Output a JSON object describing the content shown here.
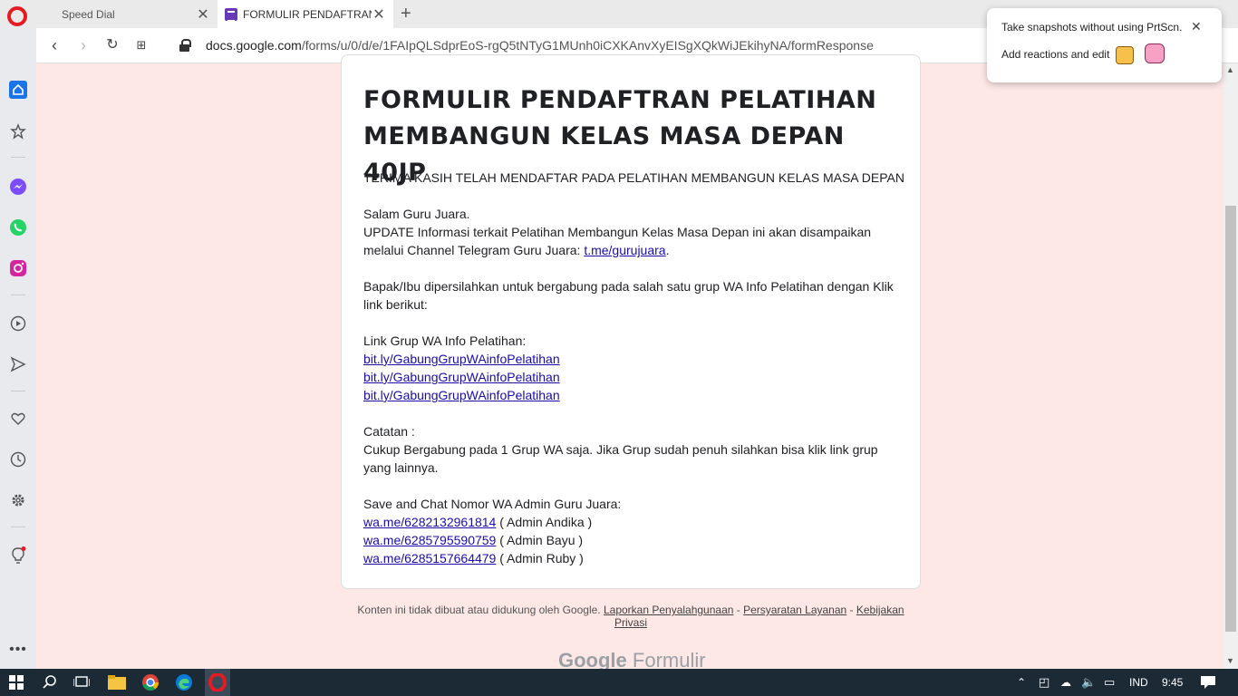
{
  "tabs": [
    {
      "label": "Speed Dial",
      "icon": "speed-dial-icon"
    },
    {
      "label": "FORMULIR PENDAFTRAN P",
      "icon": "google-forms-icon"
    }
  ],
  "address": {
    "domain": "docs.google.com",
    "path": "/forms/u/0/d/e/1FAIpQLSdprEoS-rgQ5tNTyG1MUnh0iCXKAnvXyEISgXQkWiJEkihyNA/formResponse"
  },
  "popup": {
    "line1": "Take snapshots without using PrtScn.",
    "line2": "Add reactions and edit"
  },
  "form": {
    "title": "FORMULIR PENDAFTRAN PELATIHAN MEMBANGUN KELAS MASA DEPAN 40JP",
    "thanks": "TERIMA KASIH TELAH MENDAFTAR PADA PELATIHAN MEMBANGUN KELAS MASA DEPAN",
    "greeting": "Salam Guru Juara.",
    "update_text": "UPDATE Informasi terkait Pelatihan Membangun Kelas Masa Depan ini akan disampaikan melalui Channel Telegram Guru Juara: ",
    "telegram_link": "t.me/gurujuara",
    "invite_text": "Bapak/Ibu dipersilahkan untuk bergabung pada salah satu grup WA Info Pelatihan dengan Klik link berikut:",
    "wa_group_label": "Link Grup WA Info Pelatihan:",
    "wa_group_links": [
      "bit.ly/GabungGrupWAinfoPelatihan",
      "bit.ly/GabungGrupWAinfoPelatihan",
      "bit.ly/GabungGrupWAinfoPelatihan"
    ],
    "note_label": "Catatan :",
    "note_text": "Cukup Bergabung pada 1 Grup WA saja. Jika Grup sudah penuh silahkan bisa klik link grup yang lainnya.",
    "admin_label": "Save and Chat Nomor WA Admin Guru Juara:",
    "admins": [
      {
        "link": "wa.me/6282132961814",
        "name": " ( Admin Andika )"
      },
      {
        "link": "wa.me/6285795590759",
        "name": " ( Admin Bayu )"
      },
      {
        "link": "wa.me/6285157664479",
        "name": " ( Admin Ruby )"
      }
    ]
  },
  "footer": {
    "disclaimer": "Konten ini tidak dibuat atau didukung oleh Google.",
    "report": "Laporkan Penyalahgunaan",
    "terms": "Persyaratan Layanan",
    "privacy": "Kebijakan Privasi",
    "logo_google": "Google",
    "logo_forms": "Formulir"
  },
  "taskbar": {
    "language": "IND",
    "time": "9:45"
  },
  "colors": {
    "page_bg": "#fde8e6",
    "link": "#1a0dab",
    "opera_red": "#e41b23",
    "forms_purple": "#673ab7",
    "taskbar": "#1c2a36"
  }
}
